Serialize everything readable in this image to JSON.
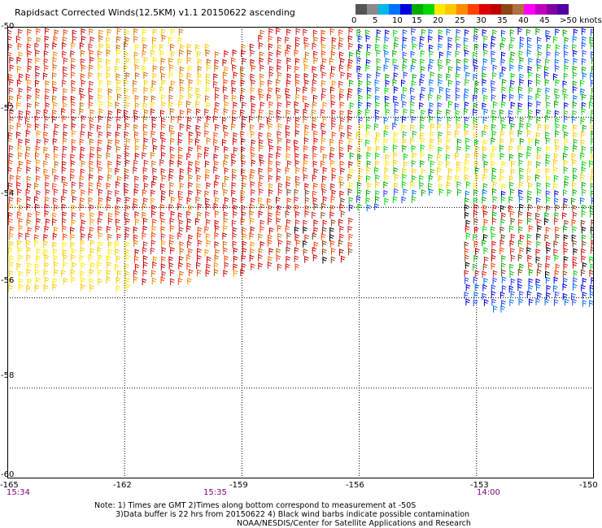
{
  "title": "Rapidsact Corrected Winds(12.5KM) v1.1 20150622 ascending",
  "colorbar": {
    "labels": [
      "0",
      "5",
      "10",
      "15",
      "20",
      "25",
      "30",
      "35",
      "40",
      "45",
      ">50 knots"
    ],
    "colors": [
      "#555555",
      "#8a8a8a",
      "#00b8e8",
      "#0070ff",
      "#0000e0",
      "#00aa00",
      "#00d800",
      "#ffe800",
      "#ffc800",
      "#ff8c00",
      "#ff4000",
      "#e00000",
      "#c00000",
      "#8b4513",
      "#b07040",
      "#ff00ff",
      "#c000c0",
      "#8000a0",
      "#5000a0"
    ]
  },
  "axes": {
    "lat_labels": [
      "-50",
      "-52",
      "-54",
      "-56",
      "-58",
      "-60"
    ],
    "lon_labels": [
      "-165",
      "-162",
      "-159",
      "-156",
      "-153",
      "-150"
    ],
    "time_labels": [
      "15:34",
      "15:35",
      "14:00"
    ]
  },
  "map": {
    "lat_range": [
      -60,
      -50
    ],
    "lon_range": [
      -165,
      -150
    ],
    "grid": true,
    "grid_lats": [
      -52,
      -54,
      -56,
      -58
    ],
    "grid_lons": [
      -162,
      -159,
      -156,
      -153
    ]
  },
  "notes": [
    "Note: 1) Times are GMT 2)Times along bottom correspond to measurement at -50S",
    "3)Data buffer is 22 hrs from 20150622 4) Black wind barbs indicate possible contamination",
    "NOAA/NESDIS/Center for Satellite Applications and Research"
  ]
}
